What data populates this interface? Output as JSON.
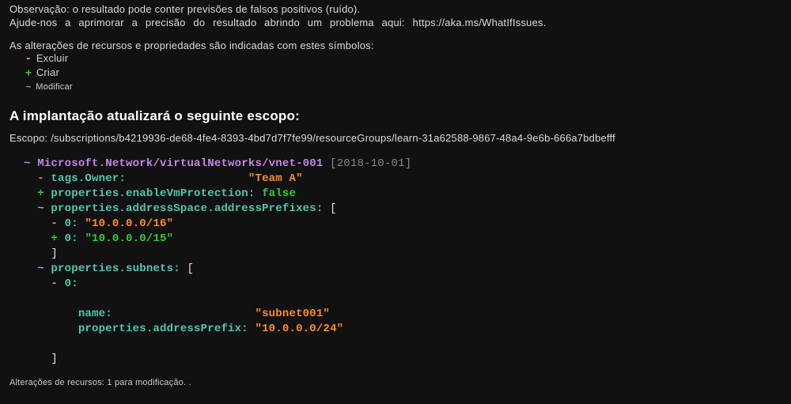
{
  "notes": {
    "line1": "Observação: o resultado pode conter previsões de falsos positivos (ruído).",
    "line2": "Ajude-nos a aprimorar a precisão do resultado abrindo um problema aqui: https://aka.ms/WhatIfIssues."
  },
  "legend": {
    "title": "As alterações de recursos e propriedades são indicadas com estes símbolos:",
    "delete": {
      "sym": "-",
      "label": "Excluir"
    },
    "create": {
      "sym": "+",
      "label": "Criar"
    },
    "modify": {
      "sym": "~",
      "label": "Modificar"
    }
  },
  "heading": "A implantação atualizará o seguinte escopo:",
  "scope": {
    "label": "Escopo: ",
    "value": "/subscriptions/b4219936-de68-4fe4-8393-4bd7d7f7fe99/resourceGroups/learn-31a62588-9867-48a4-9e6b-666a7bdbefff"
  },
  "diff": {
    "res_sym": "~",
    "res_path": "Microsoft.Network/virtualNetworks/vnet-001",
    "res_api": "[2018-10-01]",
    "owner_sym": "-",
    "owner_key": "tags.Owner:",
    "owner_pad": "                  ",
    "owner_val": "\"Team A\"",
    "vmprot_sym": "+",
    "vmprot_key": "properties.enableVmProtection:",
    "vmprot_val": "false",
    "addr_sym": "~",
    "addr_key": "properties.addressSpace.addressPrefixes:",
    "addr_open": "[",
    "addr_old_sym": "-",
    "addr_old_idx": "0:",
    "addr_old_val": "\"10.0.0.0/16\"",
    "addr_new_sym": "+",
    "addr_new_idx": "0:",
    "addr_new_val": "\"10.0.0.0/15\"",
    "addr_close": "]",
    "sub_sym": "~",
    "sub_key": "properties.subnets:",
    "sub_open": "[",
    "sub_idx_sym": "-",
    "sub_idx": "0:",
    "sub_name_key": "name:",
    "sub_name_pad": "                     ",
    "sub_name_val": "\"subnet001\"",
    "sub_pfx_key": "properties.addressPrefix:",
    "sub_pfx_val": "\"10.0.0.0/24\"",
    "sub_close": "]"
  },
  "footer": "Alterações de recursos: 1 para modificação. ."
}
